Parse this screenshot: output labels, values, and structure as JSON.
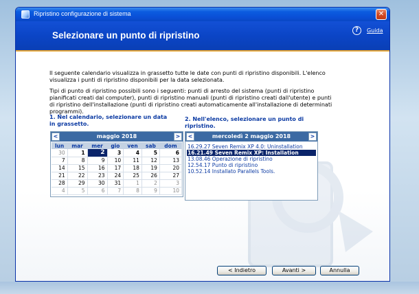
{
  "window": {
    "title": "Ripristino configurazione di sistema",
    "close_glyph": "✕"
  },
  "header": {
    "title": "Selezionare un punto di ripristino",
    "help_icon_glyph": "?",
    "help_label": "Guida"
  },
  "intro": {
    "paragraph1": "Il seguente calendario visualizza in grassetto tutte le date con punti di ripristino disponibili. L'elenco visualizza i punti di ripristino disponibili per la data selezionata.",
    "paragraph2": "Tipi di punto di ripristino possibili sono i seguenti: punti di arresto del sistema (punti di ripristino pianificati creati dal computer), punti di ripristino manuali (punti di ripristino creati dall'utente) e punti di ripristino dell'installazione (punti di ripristino creati automaticamente all'installazione di determinati programmi)."
  },
  "step1": {
    "label": "1. Nel calendario, selezionare un data in grassetto."
  },
  "step2": {
    "label": "2. Nell'elenco, selezionare un punto di ripristino."
  },
  "calendar": {
    "prev_glyph": "<",
    "next_glyph": ">",
    "month_label": "maggio 2018",
    "weekdays": [
      "lun",
      "mar",
      "mer",
      "gio",
      "ven",
      "sab",
      "dom"
    ],
    "weeks": [
      [
        {
          "d": "30",
          "other": true
        },
        {
          "d": "1",
          "bold": true
        },
        {
          "d": "2",
          "sel": true
        },
        {
          "d": "3",
          "bold": true
        },
        {
          "d": "4",
          "bold": true
        },
        {
          "d": "5",
          "bold": true
        },
        {
          "d": "6",
          "bold": true
        }
      ],
      [
        {
          "d": "7"
        },
        {
          "d": "8"
        },
        {
          "d": "9"
        },
        {
          "d": "10"
        },
        {
          "d": "11"
        },
        {
          "d": "12"
        },
        {
          "d": "13"
        }
      ],
      [
        {
          "d": "14"
        },
        {
          "d": "15"
        },
        {
          "d": "16"
        },
        {
          "d": "17"
        },
        {
          "d": "18"
        },
        {
          "d": "19"
        },
        {
          "d": "20"
        }
      ],
      [
        {
          "d": "21"
        },
        {
          "d": "22"
        },
        {
          "d": "23"
        },
        {
          "d": "24"
        },
        {
          "d": "25"
        },
        {
          "d": "26"
        },
        {
          "d": "27"
        }
      ],
      [
        {
          "d": "28"
        },
        {
          "d": "29"
        },
        {
          "d": "30"
        },
        {
          "d": "31"
        },
        {
          "d": "1",
          "other": true
        },
        {
          "d": "2",
          "other": true
        },
        {
          "d": "3",
          "other": true
        }
      ],
      [
        {
          "d": "4",
          "other": true
        },
        {
          "d": "5",
          "other": true
        },
        {
          "d": "6",
          "other": true
        },
        {
          "d": "7",
          "other": true
        },
        {
          "d": "8",
          "other": true
        },
        {
          "d": "9",
          "other": true
        },
        {
          "d": "10",
          "other": true
        }
      ]
    ]
  },
  "restore_points": {
    "prev_glyph": "<",
    "next_glyph": ">",
    "date_label": "mercoledì 2 maggio 2018",
    "items": [
      {
        "time": "16.29.27",
        "desc": "Seven Remix XP 4.0: Uninstallation",
        "selected": false
      },
      {
        "time": "16.21.49",
        "desc": "Seven Remix XP: Installation",
        "selected": true
      },
      {
        "time": "13.08.46",
        "desc": "Operazione di ripristino",
        "selected": false
      },
      {
        "time": "12.54.17",
        "desc": "Punto di ripristino",
        "selected": false
      },
      {
        "time": "10.52.14",
        "desc": "Installato Parallels Tools.",
        "selected": false
      }
    ]
  },
  "buttons": {
    "back": "< Indietro",
    "next": "Avanti >",
    "cancel": "Annulla"
  },
  "colors": {
    "header_blue": "#0b45c6",
    "selection": "#0a246a",
    "accent_orange": "#e5a537"
  }
}
